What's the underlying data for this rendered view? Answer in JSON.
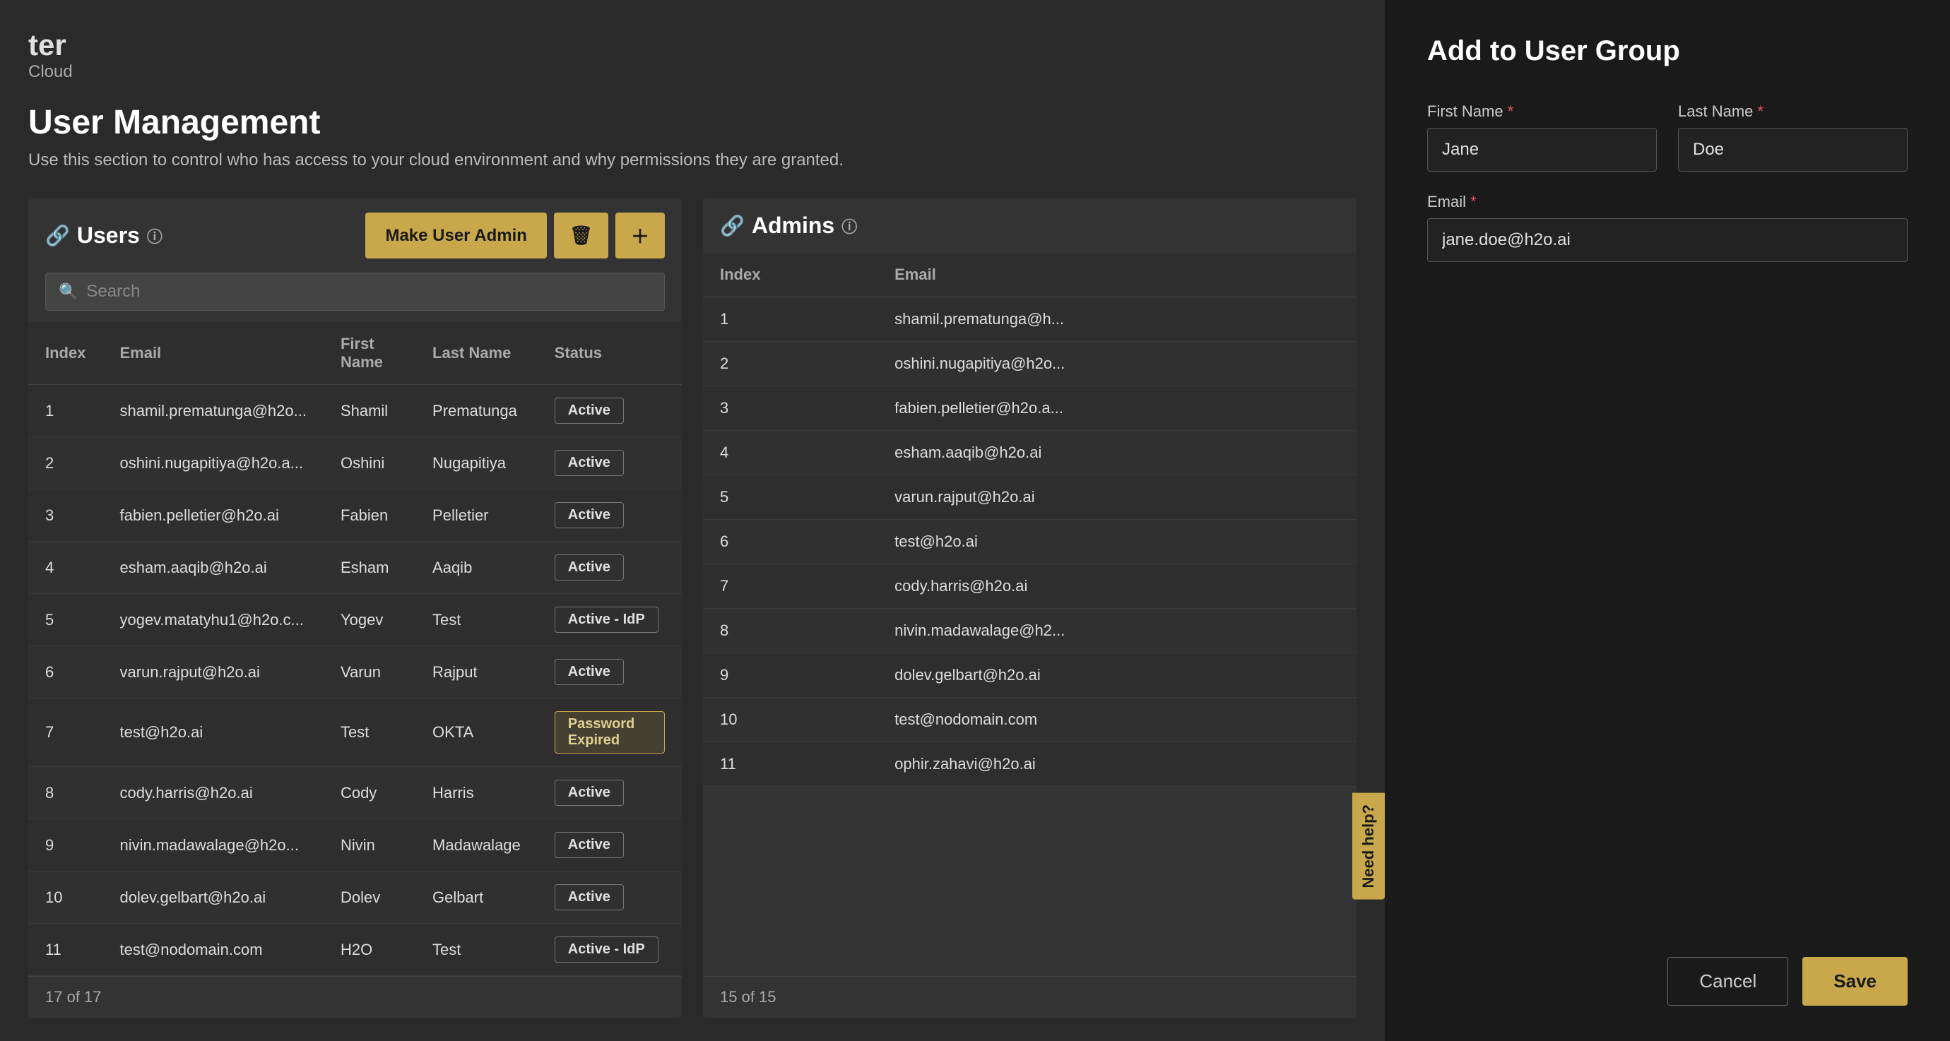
{
  "app": {
    "title": "ter",
    "subtitle": "Cloud"
  },
  "page": {
    "title": "User Management",
    "description": "Use this section to control who has access to your cloud environment and why permissions they are granted."
  },
  "users_section": {
    "title": "Users",
    "make_admin_label": "Make User Admin",
    "search_placeholder": "Search",
    "footer": "17 of 17",
    "columns": [
      "Index",
      "Email",
      "First Name",
      "Last Name",
      "Status"
    ],
    "rows": [
      {
        "index": 1,
        "email": "shamil.prematunga@h2o...",
        "first_name": "Shamil",
        "last_name": "Prematunga",
        "status": "Active",
        "status_type": "active"
      },
      {
        "index": 2,
        "email": "oshini.nugapitiya@h2o.a...",
        "first_name": "Oshini",
        "last_name": "Nugapitiya",
        "status": "Active",
        "status_type": "active"
      },
      {
        "index": 3,
        "email": "fabien.pelletier@h2o.ai",
        "first_name": "Fabien",
        "last_name": "Pelletier",
        "status": "Active",
        "status_type": "active"
      },
      {
        "index": 4,
        "email": "esham.aaqib@h2o.ai",
        "first_name": "Esham",
        "last_name": "Aaqib",
        "status": "Active",
        "status_type": "active"
      },
      {
        "index": 5,
        "email": "yogev.matatyhu1@h2o.c...",
        "first_name": "Yogev",
        "last_name": "Test",
        "status": "Active - IdP",
        "status_type": "active-idp"
      },
      {
        "index": 6,
        "email": "varun.rajput@h2o.ai",
        "first_name": "Varun",
        "last_name": "Rajput",
        "status": "Active",
        "status_type": "active"
      },
      {
        "index": 7,
        "email": "test@h2o.ai",
        "first_name": "Test",
        "last_name": "OKTA",
        "status": "Password Expired",
        "status_type": "password-expired"
      },
      {
        "index": 8,
        "email": "cody.harris@h2o.ai",
        "first_name": "Cody",
        "last_name": "Harris",
        "status": "Active",
        "status_type": "active"
      },
      {
        "index": 9,
        "email": "nivin.madawalage@h2o...",
        "first_name": "Nivin",
        "last_name": "Madawalage",
        "status": "Active",
        "status_type": "active"
      },
      {
        "index": 10,
        "email": "dolev.gelbart@h2o.ai",
        "first_name": "Dolev",
        "last_name": "Gelbart",
        "status": "Active",
        "status_type": "active"
      },
      {
        "index": 11,
        "email": "test@nodomain.com",
        "first_name": "H2O",
        "last_name": "Test",
        "status": "Active - IdP",
        "status_type": "active-idp"
      }
    ]
  },
  "admins_section": {
    "title": "Admins",
    "footer": "15 of 15",
    "columns": [
      "Index",
      "Email"
    ],
    "rows": [
      {
        "index": 1,
        "email": "shamil.prematunga@h..."
      },
      {
        "index": 2,
        "email": "oshini.nugapitiya@h2o..."
      },
      {
        "index": 3,
        "email": "fabien.pelletier@h2o.a..."
      },
      {
        "index": 4,
        "email": "esham.aaqib@h2o.ai"
      },
      {
        "index": 5,
        "email": "varun.rajput@h2o.ai"
      },
      {
        "index": 6,
        "email": "test@h2o.ai"
      },
      {
        "index": 7,
        "email": "cody.harris@h2o.ai"
      },
      {
        "index": 8,
        "email": "nivin.madawalage@h2..."
      },
      {
        "index": 9,
        "email": "dolev.gelbart@h2o.ai"
      },
      {
        "index": 10,
        "email": "test@nodomain.com"
      },
      {
        "index": 11,
        "email": "ophir.zahavi@h2o.ai"
      }
    ]
  },
  "add_user_group_form": {
    "title": "Add to User Group",
    "first_name_label": "First Name",
    "last_name_label": "Last Name",
    "email_label": "Email",
    "first_name_value": "Jane",
    "last_name_value": "Doe",
    "email_value": "jane.doe@h2o.ai",
    "cancel_label": "Cancel",
    "save_label": "Save",
    "required_marker": "*"
  },
  "need_help": {
    "label": "Need help?"
  }
}
